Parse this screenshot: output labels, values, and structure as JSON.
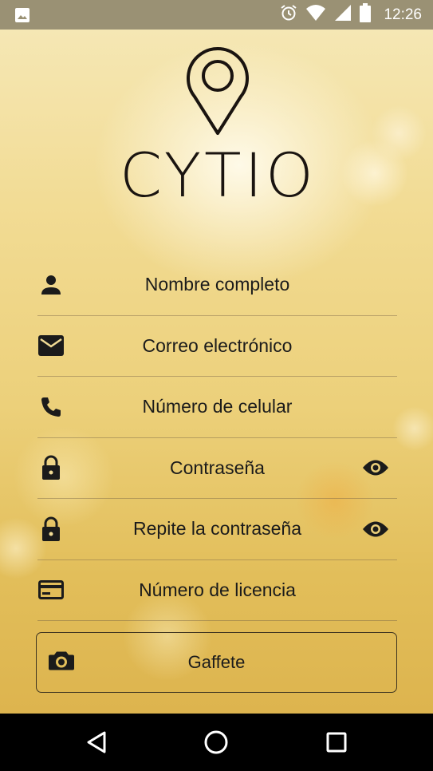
{
  "status_bar": {
    "time": "12:26",
    "icons": [
      "image-icon",
      "alarm-icon",
      "wifi-icon",
      "signal-icon",
      "battery-icon"
    ]
  },
  "logo": {
    "text": "CYTIO"
  },
  "form": {
    "fields": [
      {
        "label": "Nombre completo",
        "icon": "person-icon"
      },
      {
        "label": "Correo electrónico",
        "icon": "mail-icon"
      },
      {
        "label": "Número de celular",
        "icon": "phone-icon"
      },
      {
        "label": "Contraseña",
        "icon": "lock-icon",
        "toggle": "eye-icon"
      },
      {
        "label": "Repite la contraseña",
        "icon": "lock-icon",
        "toggle": "eye-icon"
      },
      {
        "label": "Número de licencia",
        "icon": "card-icon"
      }
    ],
    "badge_button": {
      "label": "Gaffete",
      "icon": "camera-icon"
    }
  },
  "nav_bar": {
    "icons": [
      "back-icon",
      "home-icon",
      "recents-icon"
    ]
  },
  "colors": {
    "status_bar": "#9a9174",
    "text": "#1b1b1b",
    "background_gold": "#ecd07a"
  }
}
